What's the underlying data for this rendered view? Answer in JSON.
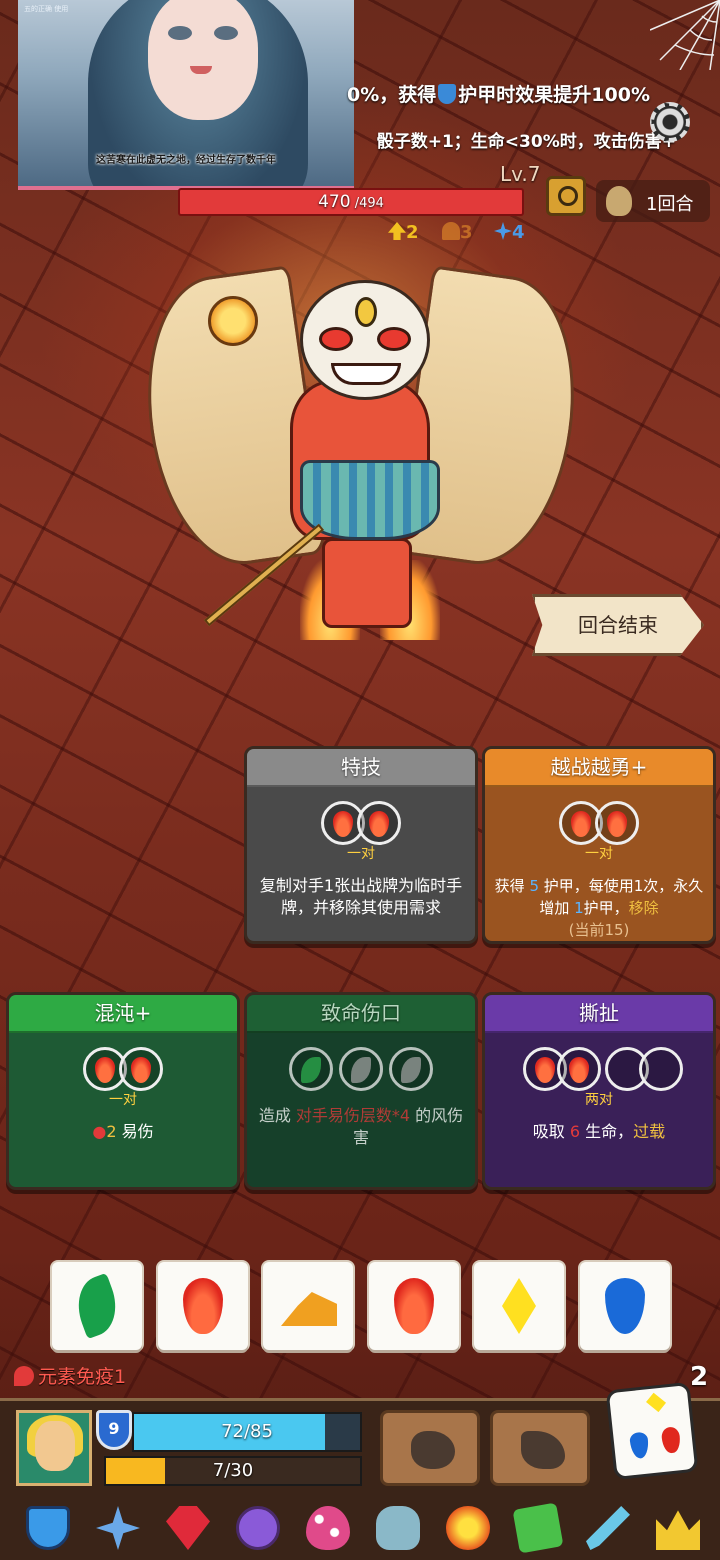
{
  "portrait": {
    "caption": "这苦寒在此虚无之地，经过生存了数千年",
    "tiny_text": "五的正确 使用"
  },
  "enemy": {
    "effect_line1_prefix": "0%，获得",
    "effect_line1_suffix": "护甲时效果提升100%",
    "effect_line2": "骰子数+1；生命<30%时，攻击伤害+",
    "level": "Lv.7",
    "hp_current": "470",
    "hp_max": " /494",
    "intents": [
      {
        "value": "2",
        "color": "#f2c020",
        "icon": "sword-icon"
      },
      {
        "value": "3",
        "color": "#e8902a",
        "icon": "claw-icon"
      },
      {
        "value": "4",
        "color": "#4a9ae8",
        "icon": "snowflake-icon"
      }
    ]
  },
  "round": {
    "label": "1回合"
  },
  "end_turn": {
    "label": "回合结束"
  },
  "cards": [
    {
      "title": "特技",
      "req": "一对",
      "desc": "复制对手1张出战牌为临时手牌，并移除其使用需求"
    },
    {
      "title": "越战越勇+",
      "req": "一对",
      "desc_a": "获得 ",
      "desc_armor": "5",
      "desc_b": " 护甲，每使用1次，永久增加 ",
      "desc_armor2": "1",
      "desc_c": "护甲，",
      "desc_remove": "移除",
      "desc_current": "(当前15)"
    },
    {
      "title": "混沌+",
      "req": "一对",
      "desc_num": "2",
      "desc_text": " 易伤"
    },
    {
      "title": "致命伤口",
      "desc_a": "造成 ",
      "desc_hl": "对手易伤层数*4",
      "desc_b": " 的风伤害"
    },
    {
      "title": "撕扯",
      "req": "两对",
      "desc_a": "吸取 ",
      "desc_num": "6",
      "desc_b": " 生命，",
      "desc_overload": "过载"
    }
  ],
  "dice": [
    "leaf",
    "fire",
    "earth",
    "fire",
    "bolt",
    "water"
  ],
  "status": {
    "label": "元素免疫1"
  },
  "dice_remaining": "2",
  "hero": {
    "armor": "9",
    "hp_text": "72/85",
    "hp_fraction": 0.847,
    "energy_text": "7/30",
    "energy_fraction": 0.233
  },
  "toolbar": [
    "shield-relic-icon",
    "compass-icon",
    "ruby-icon",
    "amulet-icon",
    "spotted-egg-icon",
    "beast-skull-icon",
    "lightning-orb-icon",
    "moss-tablet-icon",
    "dagger-icon",
    "crown-icon"
  ],
  "colors": {
    "accent_hp": "#e23a3a",
    "hero_hp": "#4ac8f0",
    "energy": "#f8b820"
  }
}
